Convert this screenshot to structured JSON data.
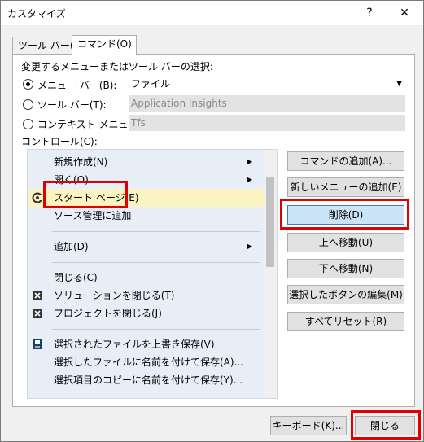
{
  "window": {
    "title": "カスタマイズ",
    "help": "?",
    "close": "✕"
  },
  "tabs": [
    {
      "label": "ツール バー(S)"
    },
    {
      "label": "コマンド(O)"
    }
  ],
  "selection_label": "変更するメニューまたはツール バーの選択:",
  "radios": [
    {
      "label": "メニュー バー(B):",
      "value": "ファイル",
      "checked": true
    },
    {
      "label": "ツール バー(T):",
      "value": "Application Insights",
      "checked": false
    },
    {
      "label": "コンテキスト メニュー(X):",
      "value": "Tfs",
      "checked": false
    }
  ],
  "controls_label": "コントロール(C):",
  "list_items": [
    {
      "label": "新規作成(N)",
      "submenu": true,
      "icon": ""
    },
    {
      "label": "開く(O)",
      "submenu": true,
      "icon": ""
    },
    {
      "label": "スタート ページ(E)",
      "submenu": false,
      "icon": "start-page-icon"
    },
    {
      "label": "ソース管理に追加",
      "submenu": false,
      "icon": ""
    },
    {
      "label": "追加(D)",
      "submenu": true,
      "icon": ""
    },
    {
      "label": "閉じる(C)",
      "submenu": false,
      "icon": ""
    },
    {
      "label": "ソリューションを閉じる(T)",
      "submenu": false,
      "icon": "close-solution-icon"
    },
    {
      "label": "プロジェクトを閉じる(J)",
      "submenu": false,
      "icon": "close-project-icon"
    },
    {
      "label": "選択されたファイルを上書き保存(V)",
      "submenu": false,
      "icon": "save-icon"
    },
    {
      "label": "選択したファイルに名前を付けて保存(A)...",
      "submenu": false,
      "icon": ""
    },
    {
      "label": "選択項目のコピーに名前を付けて保存(Y)...",
      "submenu": false,
      "icon": ""
    }
  ],
  "buttons": {
    "add_command": "コマンドの追加(A)...",
    "add_menu": "新しいメニューの追加(E)",
    "delete": "削除(D)",
    "move_up": "上へ移動(U)",
    "move_down": "下へ移動(N)",
    "edit_button": "選択したボタンの編集(M)",
    "reset_all": "すべてリセット(R)"
  },
  "bottom": {
    "keyboard": "キーボード(K)...",
    "close": "閉じる"
  },
  "colors": {
    "highlight_box": "#e00000",
    "selected_row": "#fbf3c2",
    "list_bg": "#e8eef8"
  }
}
